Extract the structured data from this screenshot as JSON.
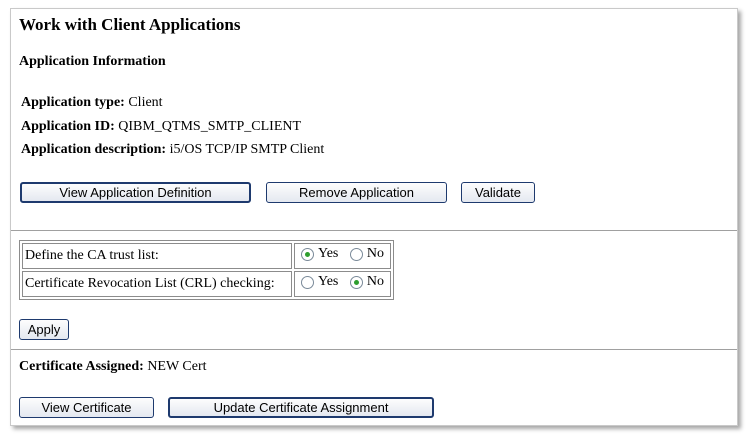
{
  "page": {
    "title": "Work with Client Applications"
  },
  "app_info": {
    "heading": "Application Information",
    "type_label": "Application type:",
    "type_value": "Client",
    "id_label": "Application ID:",
    "id_value": "QIBM_QTMS_SMTP_CLIENT",
    "desc_label": "Application description:",
    "desc_value": "i5/OS TCP/IP SMTP Client"
  },
  "actions": {
    "view_definition": "View Application Definition",
    "remove": "Remove Application",
    "validate": "Validate"
  },
  "options": {
    "ca_trust_label": "Define the CA trust list:",
    "ca_trust_value": "Yes",
    "crl_label": "Certificate Revocation List (CRL) checking:",
    "crl_value": "No",
    "yes_label": "Yes",
    "no_label": "No",
    "apply": "Apply"
  },
  "certificate": {
    "label": "Certificate Assigned:",
    "value": "NEW Cert",
    "view_button": "View Certificate",
    "update_button": "Update Certificate Assignment"
  },
  "colors": {
    "button_border": "#1e3a6e",
    "radio_checked": "#2e9e2e",
    "divider": "#a0a0a0"
  }
}
